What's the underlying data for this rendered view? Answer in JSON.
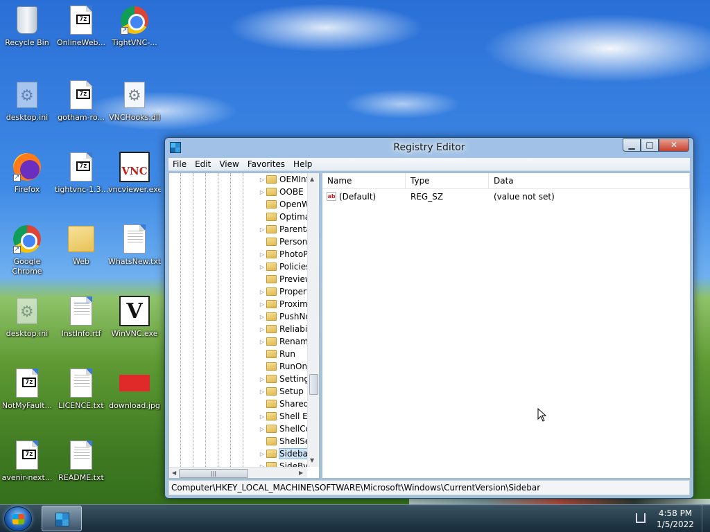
{
  "desktop": {
    "icons": [
      {
        "label": "Recycle Bin",
        "icon": "recycle-bin-icon"
      },
      {
        "label": "OnlineWeb...",
        "icon": "7z-archive-icon"
      },
      {
        "label": "TightVNC-...",
        "icon": "chrome-shortcut-icon"
      },
      {
        "label": "desktop.ini",
        "icon": "config-file-icon"
      },
      {
        "label": "gotham-ro...",
        "icon": "7z-archive-icon"
      },
      {
        "label": "VNCHooks.dll",
        "icon": "dll-file-icon"
      },
      {
        "label": "Firefox",
        "icon": "firefox-icon"
      },
      {
        "label": "tightvnc-1.3...",
        "icon": "7z-archive-icon"
      },
      {
        "label": "vncviewer.exe",
        "icon": "vnc-viewer-icon",
        "badge": "VNC"
      },
      {
        "label": "Google Chrome",
        "icon": "chrome-icon"
      },
      {
        "label": "Web",
        "icon": "folder-icon"
      },
      {
        "label": "WhatsNew.txt",
        "icon": "text-file-icon"
      },
      {
        "label": "desktop.ini",
        "icon": "config-file-icon"
      },
      {
        "label": "InstInfo.rtf",
        "icon": "rtf-file-icon"
      },
      {
        "label": "WinVNC.exe",
        "icon": "winvnc-icon",
        "badge": "V"
      },
      {
        "label": "NotMyFault...",
        "icon": "7z-archive-icon"
      },
      {
        "label": "LICENCE.txt",
        "icon": "text-file-icon"
      },
      {
        "label": "download.jpg",
        "icon": "image-file-icon"
      },
      {
        "label": "avenir-next...",
        "icon": "7z-archive-icon"
      },
      {
        "label": "README.txt",
        "icon": "text-file-icon"
      }
    ],
    "archive_glyph": "7z"
  },
  "window": {
    "title": "Registry Editor",
    "minimize_glyph": "▁",
    "maximize_glyph": "□",
    "close_glyph": "✕",
    "menu": [
      "File",
      "Edit",
      "View",
      "Favorites",
      "Help"
    ],
    "tree_items": [
      {
        "label": "OEMInf",
        "expandable": true
      },
      {
        "label": "OOBE",
        "expandable": true
      },
      {
        "label": "OpenW",
        "expandable": false
      },
      {
        "label": "Optima",
        "expandable": false
      },
      {
        "label": "Parenta",
        "expandable": true
      },
      {
        "label": "Person",
        "expandable": false
      },
      {
        "label": "PhotoP",
        "expandable": true
      },
      {
        "label": "Policies",
        "expandable": true
      },
      {
        "label": "Preview",
        "expandable": false
      },
      {
        "label": "Propert",
        "expandable": true
      },
      {
        "label": "Proxim",
        "expandable": true
      },
      {
        "label": "PushNo",
        "expandable": true
      },
      {
        "label": "Reliabi",
        "expandable": true
      },
      {
        "label": "Renam",
        "expandable": true
      },
      {
        "label": "Run",
        "expandable": false
      },
      {
        "label": "RunOn",
        "expandable": false
      },
      {
        "label": "Setting",
        "expandable": true
      },
      {
        "label": "Setup",
        "expandable": true
      },
      {
        "label": "SharedI",
        "expandable": false
      },
      {
        "label": "Shell Ex",
        "expandable": true
      },
      {
        "label": "ShellCo",
        "expandable": true
      },
      {
        "label": "ShellSe",
        "expandable": false
      },
      {
        "label": "Sidebar",
        "expandable": true,
        "selected": true
      },
      {
        "label": "SideBy",
        "expandable": true
      }
    ],
    "columns": {
      "name": "Name",
      "type": "Type",
      "data": "Data"
    },
    "values": [
      {
        "icon_text": "ab",
        "name": "(Default)",
        "type": "REG_SZ",
        "data": "(value not set)"
      }
    ],
    "statusbar": "Computer\\HKEY_LOCAL_MACHINE\\SOFTWARE\\Microsoft\\Windows\\CurrentVersion\\Sidebar",
    "hscroll_grip": "|||"
  },
  "taskbar": {
    "time": "4:58 PM",
    "date": "1/5/2022"
  }
}
